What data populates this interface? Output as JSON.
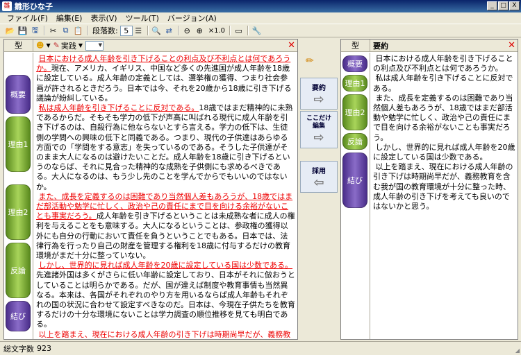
{
  "window": {
    "title": "雛形ひな子",
    "min": "_",
    "max": "□",
    "close": "X"
  },
  "menu": [
    "ファイル(F)",
    "編集(E)",
    "表示(V)",
    "ツール(T)",
    "バージョン(A)"
  ],
  "toolbar": {
    "paragraph_label": "段落数:",
    "paragraph_value": "5",
    "zoom": "×1.0"
  },
  "left": {
    "type_header": "型",
    "mode_dropdown": "実践",
    "types": [
      "概要",
      "理由1",
      "理由2",
      "反論",
      "結び"
    ],
    "paragraphs": [
      {
        "red": "日本における成人年齢を引き下げることの利点及び不利点とは何であろうか。",
        "rest": "現在、アメリカ、イギリス、中国など多くの先進国が成人年齢を18歳に設定している。成人年齢の定義としては、選挙権の獲得、つまり社会参画が許されるときだろう。日本では今、それを20歳から18歳に引き下げる議論が紛糾している。"
      },
      {
        "red": "私は成人年齢を引き下げることに反対である。",
        "rest": "18歳ではまだ精神的に未熟であるからだ。そもそも学力の低下が声高に叫ばれる現代に成人年齢を引き下げるのは、自殺行為に他ならないとすら言える。学力の低下は、生徒側の学問への興味の低下と同義である。つまり、現代の子供達はあらゆる方面での「学問をする意志」を失っているのである。そうした子供達がそのまま大人になるのは避けたいことだ。成人年齢を18歳に引き下げるというのならば、それに見合った精神的な成熟を子供側にも求めるべきである。大人になるのは、もう少し先のことを学んでからでもいいのではないか。"
      },
      {
        "red": "また、成長を定義するのは困難であり当然個人差もあろうが、18歳ではまだ部活動や勉学に忙しく、政治や己の責任にまで目を向ける余裕がないことも事実だろう。",
        "rest": "成人年齢を引き下げるということは未成熟な者に成人の権利を与えることをも意味する。大人になるということは、参政権の獲得以外にも自分の行動において責任を負うということでもある。日本では、法律行為を行ったり自己の財産を管理する権利を18歳に付与するだけの教育環境がまだ十分に整っていない。"
      },
      {
        "red": "しかし、世界的に見れば成人年齢を20歳に設定している国は少数である。",
        "rest": "先進諸外国は多くがさらに低い年齢に設定しており、日本がそれに倣おうとしていることは明らかである。だが、国が違えば制度や教育事情も当然異なる。本来は、各国がそれぞれのやり方を用いるならば成人年齢もそれぞれの国の状況に合わせて設定すべきなのだ。日本は、今現在子供たちを教育するだけの十分な環境にないことは学力調査の順位推移を見ても明白である。"
      },
      {
        "red": "以上を踏まえ、現在における成人年齢の引き下げは時期尚早だが、義務教育を含む我が国の教育環境が十分に整った時、成人年齢の引き下げを考えても良いのではないかと思う。",
        "rest": ""
      }
    ]
  },
  "middle": {
    "btn_summary": "要約",
    "btn_edit": "ここだけ編集",
    "btn_adopt": "採用"
  },
  "right": {
    "type_header": "型",
    "summary_header": "要約",
    "types": [
      "概要",
      "理由1",
      "理由2",
      "反論",
      "結び"
    ],
    "paragraphs": [
      "日本における成人年齢を引き下げることの利点及び不利点とは何であろうか。",
      "私は成人年齢を引き下げることに反対である。",
      "また、成長を定義するのは困難であり当然個人差もあろうが、18歳ではまだ部活動や勉学に忙しく、政治や己の責任にまで目を向ける余裕がないことも事実だろう。",
      "しかし、世界的に見れば成人年齢を20歳に設定している国は少数である。",
      "以上を踏まえ、現在における成人年齢の引き下げは時期尚早だが、義務教育を含む我が国の教育環境が十分に整った時、成人年齢の引き下げを考えても良いのではないかと思う。"
    ]
  },
  "status": {
    "char_count_label": "総文字数",
    "char_count": "923"
  }
}
